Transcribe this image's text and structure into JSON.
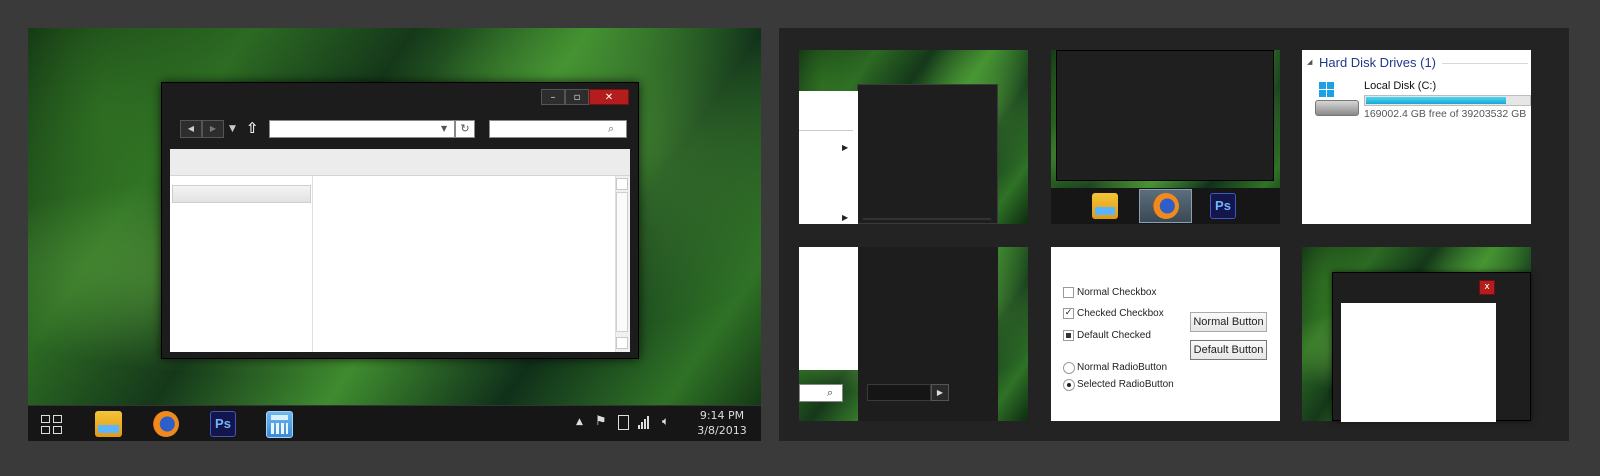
{
  "taskbar": {
    "time": "9:14 PM",
    "date": "3/8/2013",
    "apps": [
      {
        "icon": "explorer-icon"
      },
      {
        "icon": "firefox-icon"
      },
      {
        "icon": "photoshop-icon",
        "label": "Ps"
      },
      {
        "icon": "calculator-icon"
      }
    ]
  },
  "window": {
    "buttons": [
      "–",
      "▫",
      "✕"
    ]
  },
  "drive_panel": {
    "group_title": "Hard Disk Drives (1)",
    "drive_name": "Local Disk (C:)",
    "drive_free": "169002.4 GB free of 39203532 GB",
    "used_fraction": 0.85
  },
  "taskbar_preview": {
    "ps_label": "Ps"
  },
  "controls": {
    "normal_checkbox": "Normal Checkbox",
    "checked_checkbox": "Checked Checkbox",
    "default_checked": "Default Checked",
    "normal_radio": "Normal RadioButton",
    "selected_radio": "Selected RadioButton",
    "normal_button": "Normal Button",
    "default_button": "Default Button",
    "check_mark": "✓"
  },
  "dialog_close": "x"
}
